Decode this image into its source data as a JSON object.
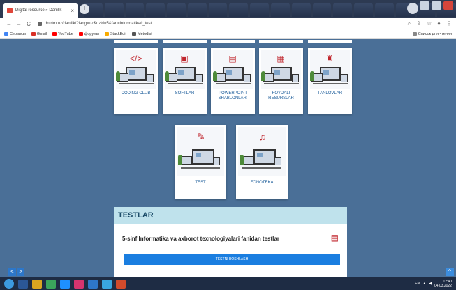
{
  "browser": {
    "tab_title": "Digital resource » Danilik",
    "tab_close": "×",
    "new_tab": "+",
    "url": "dn.rtm.uz/danilik/?lang=uz&ozid=5&fan=informatika#_test",
    "back": "←",
    "forward": "→",
    "reload": "C",
    "bookmarks": [
      {
        "label": "Сервисы",
        "color": "#4285f4"
      },
      {
        "label": "Gmail",
        "color": "#d93025"
      },
      {
        "label": "YouTube",
        "color": "#ff0000"
      },
      {
        "label": "форумы",
        "color": "#ff0000"
      },
      {
        "label": "StackEdit",
        "color": "#f9ab00"
      },
      {
        "label": "Metodist",
        "color": "#555555"
      }
    ],
    "bookmarks_right": "Список для чтения"
  },
  "cards_row1": [
    {
      "label": "CODING CLUB",
      "icon": "</>"
    },
    {
      "label": "SOFTLAR",
      "icon": "▣"
    },
    {
      "label": "POWERPOINT SHABLONLARI",
      "icon": "▤"
    },
    {
      "label": "FOYDALI RESURSLAR",
      "icon": "▦"
    },
    {
      "label": "TANLOVLAR",
      "icon": "♜"
    }
  ],
  "cards_row2": [
    {
      "label": "TEST",
      "icon": "✎"
    },
    {
      "label": "FONOTEKA",
      "icon": "♫"
    }
  ],
  "testlar": {
    "heading": "TESTLAR",
    "subject": "5-sinf Informatika va axborot texnologiyalari fanidan testlar",
    "button": "TESTNI BOSHLASH"
  },
  "pager": {
    "prev": "<",
    "next": ">"
  },
  "scroll_top": "^",
  "taskbar": {
    "lang": "EN",
    "time": "12:40",
    "date": "04.03.2022"
  }
}
